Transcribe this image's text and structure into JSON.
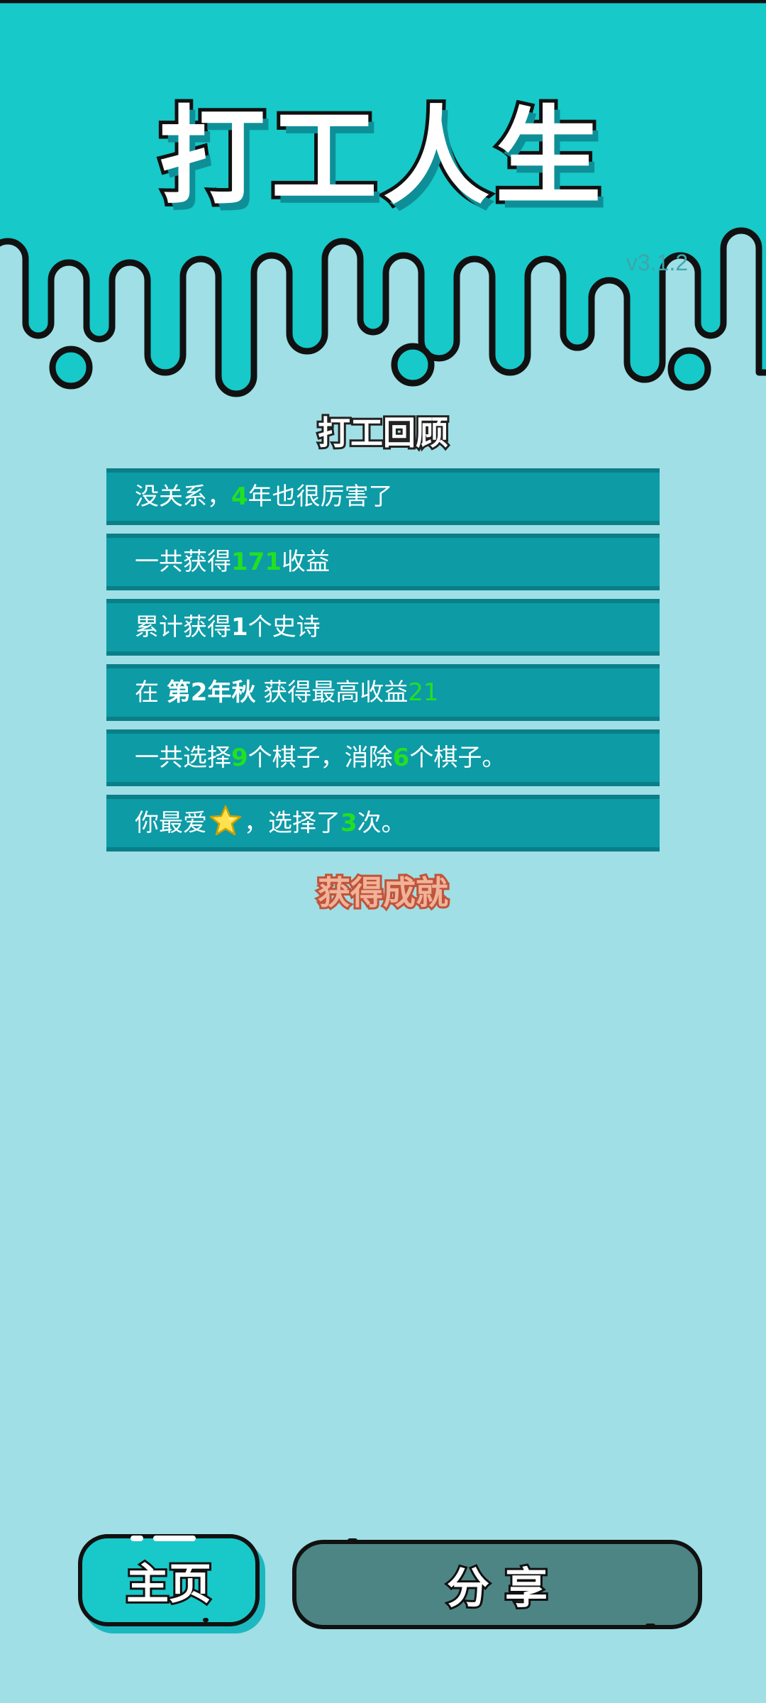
{
  "header": {
    "title": "打工人生",
    "version": "v3.1.2",
    "band_color": "#17c9c9"
  },
  "review": {
    "title": "打工回顾",
    "rows": [
      {
        "pre": "没关系，",
        "num": "4",
        "post": "年也很厉害了"
      },
      {
        "pre": "一共获得",
        "num": "171",
        "post": "收益"
      },
      {
        "pre": "累计获得",
        "num": "1",
        "post": "个史诗"
      },
      {
        "pre": "在 ",
        "season": "第2年秋",
        "mid": " 获得最高收益",
        "num": "21"
      },
      {
        "pre": "一共选择",
        "num1": "9",
        "mid": "个棋子，消除",
        "num2": "6",
        "post": "个棋子。"
      },
      {
        "pre": "你最爱",
        "icon": "star-icon",
        "mid": "，选择了",
        "num": "3",
        "post": "次。"
      }
    ]
  },
  "achievement": {
    "title": "获得成就"
  },
  "buttons": {
    "home_label": "主页",
    "share_label": "分享"
  },
  "colors": {
    "background": "#a0dfe6",
    "row_bg": "#0d9ba6",
    "highlight": "#22e022",
    "share_button": "#4d8585"
  }
}
